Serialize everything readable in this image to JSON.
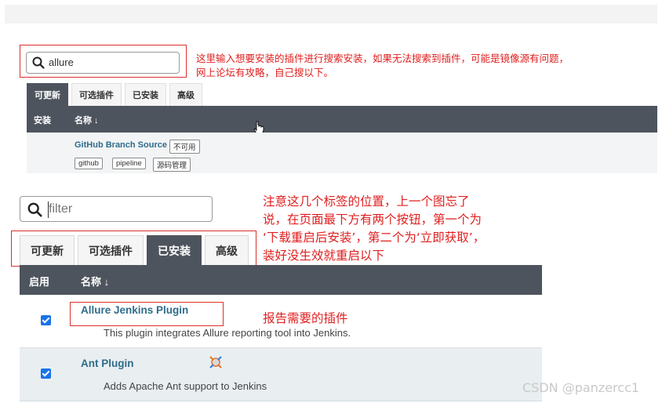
{
  "top_panel": {
    "search": {
      "value": "allure"
    },
    "annotation": "这里输入想要安装的插件进行搜索安装，如果无法搜索到插件，可能是镜像源有问题，\n网上论坛有攻略，自己搜以下。",
    "tabs": [
      "可更新",
      "可选插件",
      "已安装",
      "高级"
    ],
    "active_tab": "可更新",
    "table_headers": {
      "install": "安装",
      "name": "名称 ↓"
    },
    "plugin": {
      "name": "GitHub Branch Source",
      "status_badge": "不可用",
      "tags": [
        "github",
        "pipeline",
        "源码管理"
      ]
    }
  },
  "bottom_panel": {
    "search": {
      "placeholder": "filter"
    },
    "annotation_tabs": "注意这几个标签的位置，上一个图忘了\n说，在页面最下方有两个按钮，第一个为\n‘下载重启后安装’，第二个为‘立即获取’，\n装好没生效就重启以下",
    "tabs": [
      "可更新",
      "可选插件",
      "已安装",
      "高级"
    ],
    "active_tab": "已安装",
    "table_headers": {
      "enabled": "启用",
      "name": "名称 ↓"
    },
    "plugins": [
      {
        "name": "Allure Jenkins Plugin",
        "description": "This plugin integrates Allure reporting tool into Jenkins.",
        "enabled": true
      },
      {
        "name": "Ant Plugin",
        "description": "Adds Apache Ant support to Jenkins",
        "enabled": true
      }
    ],
    "annotation_plugin": "报告需要的插件"
  },
  "watermark": "CSDN @panzercc1",
  "icons": [
    "search-icon",
    "mouse-cursor-icon",
    "ant-plugin-icon",
    "checkbox-checked-icon"
  ],
  "colors": {
    "accent_red": "#e01f1f",
    "header_dark": "#4d545d",
    "link_blue": "#2e6c8a",
    "checkbox_blue": "#1a73e8"
  }
}
